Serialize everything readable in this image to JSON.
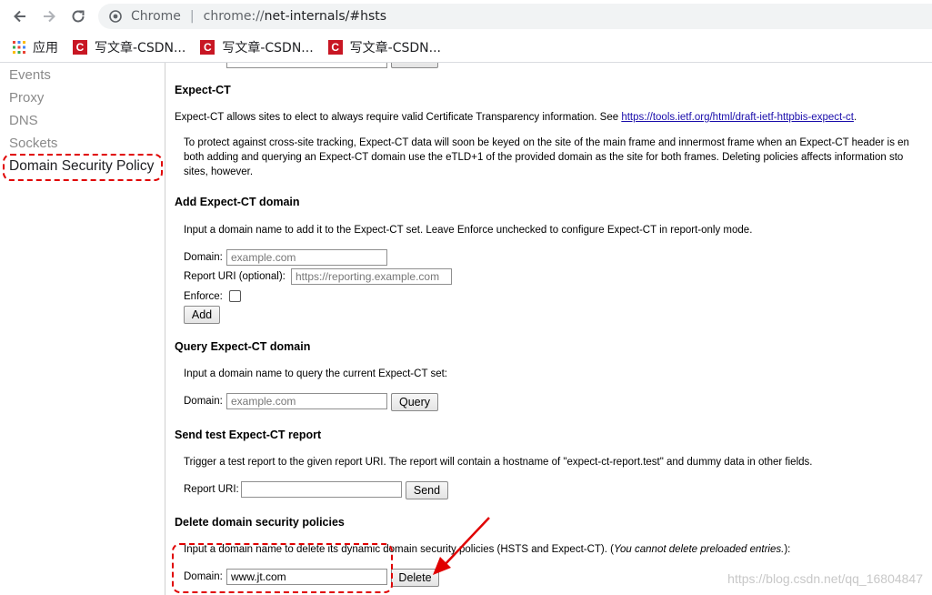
{
  "browser": {
    "site_name": "Chrome",
    "url_scheme": "chrome://",
    "url_rest": "net-internals/#hsts",
    "bookmarks": [
      {
        "label": "应用"
      },
      {
        "label": "写文章-CSDN..."
      },
      {
        "label": "写文章-CSDN..."
      },
      {
        "label": "写文章-CSDN..."
      }
    ]
  },
  "sidebar": {
    "items": [
      {
        "label": "Events"
      },
      {
        "label": "Proxy"
      },
      {
        "label": "DNS"
      },
      {
        "label": "Sockets"
      },
      {
        "label": "Domain Security Policy",
        "active": true
      }
    ]
  },
  "expect_ct": {
    "title": "Expect-CT",
    "desc": "Expect-CT allows sites to elect to always require valid Certificate Transparency information. See ",
    "desc_link": "https://tools.ietf.org/html/draft-ietf-httpbis-expect-ct",
    "desc_end": ".",
    "note_line1": "To protect against cross-site tracking, Expect-CT data will soon be keyed on the site of the main frame and innermost frame when an Expect-CT header is en",
    "note_line2": "both adding and querying an Expect-CT domain use the eTLD+1 of the provided domain as the site for both frames. Deleting policies affects information sto",
    "note_line3": "sites, however."
  },
  "add_ct": {
    "title": "Add Expect-CT domain",
    "desc": "Input a domain name to add it to the Expect-CT set. Leave Enforce unchecked to configure Expect-CT in report-only mode.",
    "domain_label": "Domain:",
    "domain_placeholder": "example.com",
    "report_label": "Report URI (optional):",
    "report_placeholder": "https://reporting.example.com",
    "enforce_label": "Enforce:",
    "add_button": "Add"
  },
  "query_ct": {
    "title": "Query Expect-CT domain",
    "desc": "Input a domain name to query the current Expect-CT set:",
    "domain_label": "Domain:",
    "domain_placeholder": "example.com",
    "query_button": "Query"
  },
  "test_ct": {
    "title": "Send test Expect-CT report",
    "desc": "Trigger a test report to the given report URI. The report will contain a hostname of \"expect-ct-report.test\" and dummy data in other fields.",
    "report_label": "Report URI:",
    "send_button": "Send"
  },
  "delete": {
    "title": "Delete domain security policies",
    "desc": "Input a domain name to delete its dynamic domain security policies (HSTS and Expect-CT). (",
    "desc_italic": "You cannot delete preloaded entries.",
    "desc_end": "):",
    "domain_label": "Domain:",
    "domain_value": "www.jt.com",
    "delete_button": "Delete"
  },
  "watermark": "https://blog.csdn.net/qq_16804847",
  "colors": {
    "annotation": "#e00000",
    "link": "#1a0dab"
  }
}
